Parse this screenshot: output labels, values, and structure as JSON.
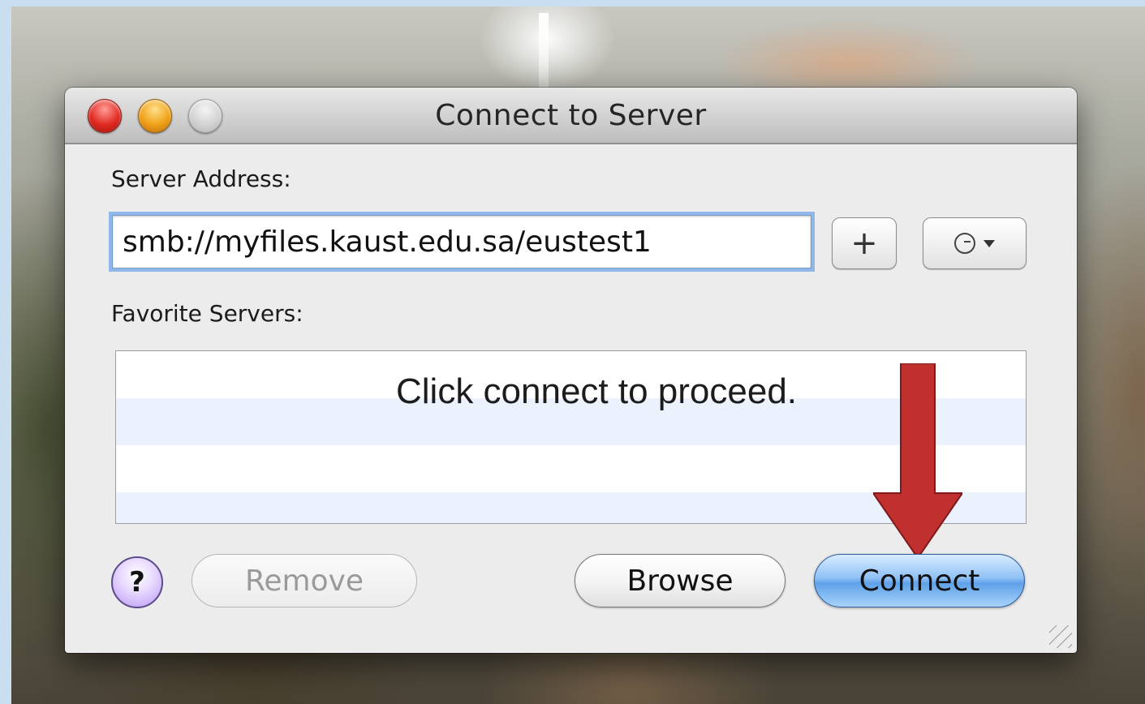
{
  "window": {
    "title": "Connect to Server"
  },
  "form": {
    "server_address_label": "Server Address:",
    "server_address_value": "smb://myfiles.kaust.edu.sa/eustest1",
    "favorite_servers_label": "Favorite Servers:",
    "favorites": []
  },
  "toolbar": {
    "add_label": "+",
    "help_label": "?",
    "remove_label": "Remove",
    "browse_label": "Browse",
    "connect_label": "Connect"
  },
  "annotation": {
    "text": "Click connect to proceed.",
    "arrow_color": "#c0302f"
  },
  "colors": {
    "accent": "#5fa1e8",
    "focus_ring": "#8fb7ea",
    "row_alt": "#ecf2fd"
  },
  "icons": {
    "add": "plus-icon",
    "recent": "clock-icon",
    "help": "question-icon"
  }
}
